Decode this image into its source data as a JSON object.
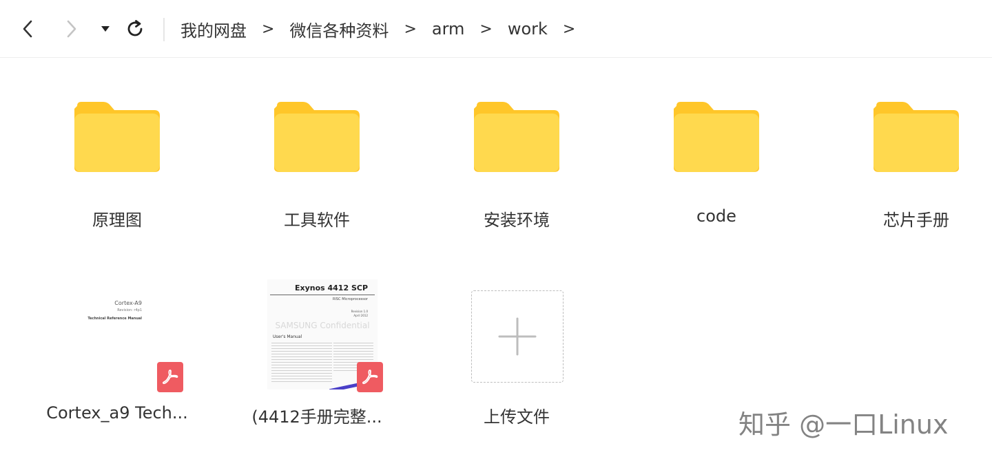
{
  "toolbar": {
    "breadcrumb": [
      "我的网盘",
      "微信各种资料",
      "arm",
      "work"
    ],
    "separator": ">"
  },
  "folders": [
    {
      "label": "原理图"
    },
    {
      "label": "工具软件"
    },
    {
      "label": "安装环境"
    },
    {
      "label": "code"
    },
    {
      "label": "芯片手册"
    }
  ],
  "files": [
    {
      "label": "Cortex_a9 Tech...",
      "type": "pdf",
      "thumb_lines": [
        "Cortex-A9",
        "Revision: r4p1",
        "Technical Reference Manual"
      ]
    },
    {
      "label": "(4412手册完整...",
      "type": "pdf",
      "thumb_lines": [
        "Exynos 4412 SCP",
        "RISC Microprocessor",
        "Revision 1.0",
        "April 2012",
        "SAMSUNG Confidential",
        "User's Manual"
      ]
    }
  ],
  "upload": {
    "label": "上传文件"
  },
  "watermark": "知乎 @一口Linux",
  "colors": {
    "folder": "#FFD94E",
    "folder_tab": "#FFC629",
    "pdf_badge": "#EF5B61",
    "text": "#333333"
  },
  "icons": [
    "back-arrow-icon",
    "forward-arrow-icon",
    "history-dropdown-icon",
    "refresh-icon",
    "folder-icon",
    "pdf-icon",
    "plus-icon"
  ]
}
